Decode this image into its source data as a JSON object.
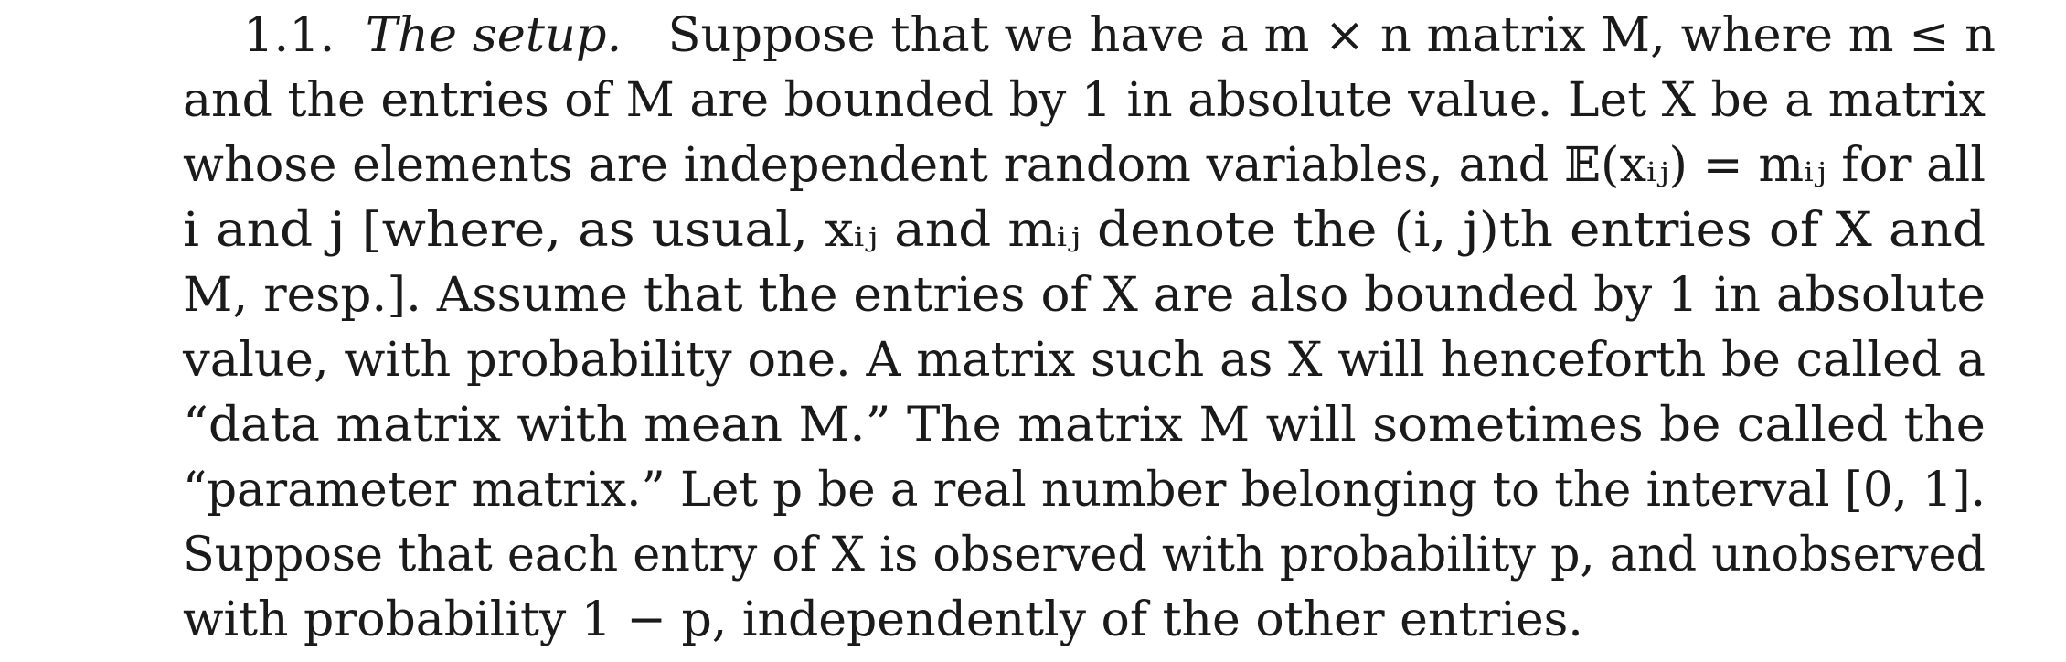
{
  "section": {
    "number": "1.1.",
    "title": "The setup.",
    "lines": [
      "Suppose that we have a m × n matrix M, where m ≤ n",
      "and the entries of M are bounded by 1 in absolute value. Let X be a matrix",
      "whose elements are independent random variables, and 𝔼(xᵢⱼ) = mᵢⱼ for all",
      "i and j [where, as usual, xᵢⱼ and mᵢⱼ denote the (i, j)th entries of X and",
      "M, resp.]. Assume that the entries of X are also bounded by 1 in absolute",
      "value, with probability one. A matrix such as X will henceforth be called a",
      "“data matrix with mean M.” The matrix M will sometimes be called the",
      "“parameter matrix.” Let p be a real number belonging to the interval [0, 1].",
      "Suppose that each entry of X is observed with probability p, and unobserved",
      "with probability 1 − p, independently of the other entries."
    ]
  }
}
